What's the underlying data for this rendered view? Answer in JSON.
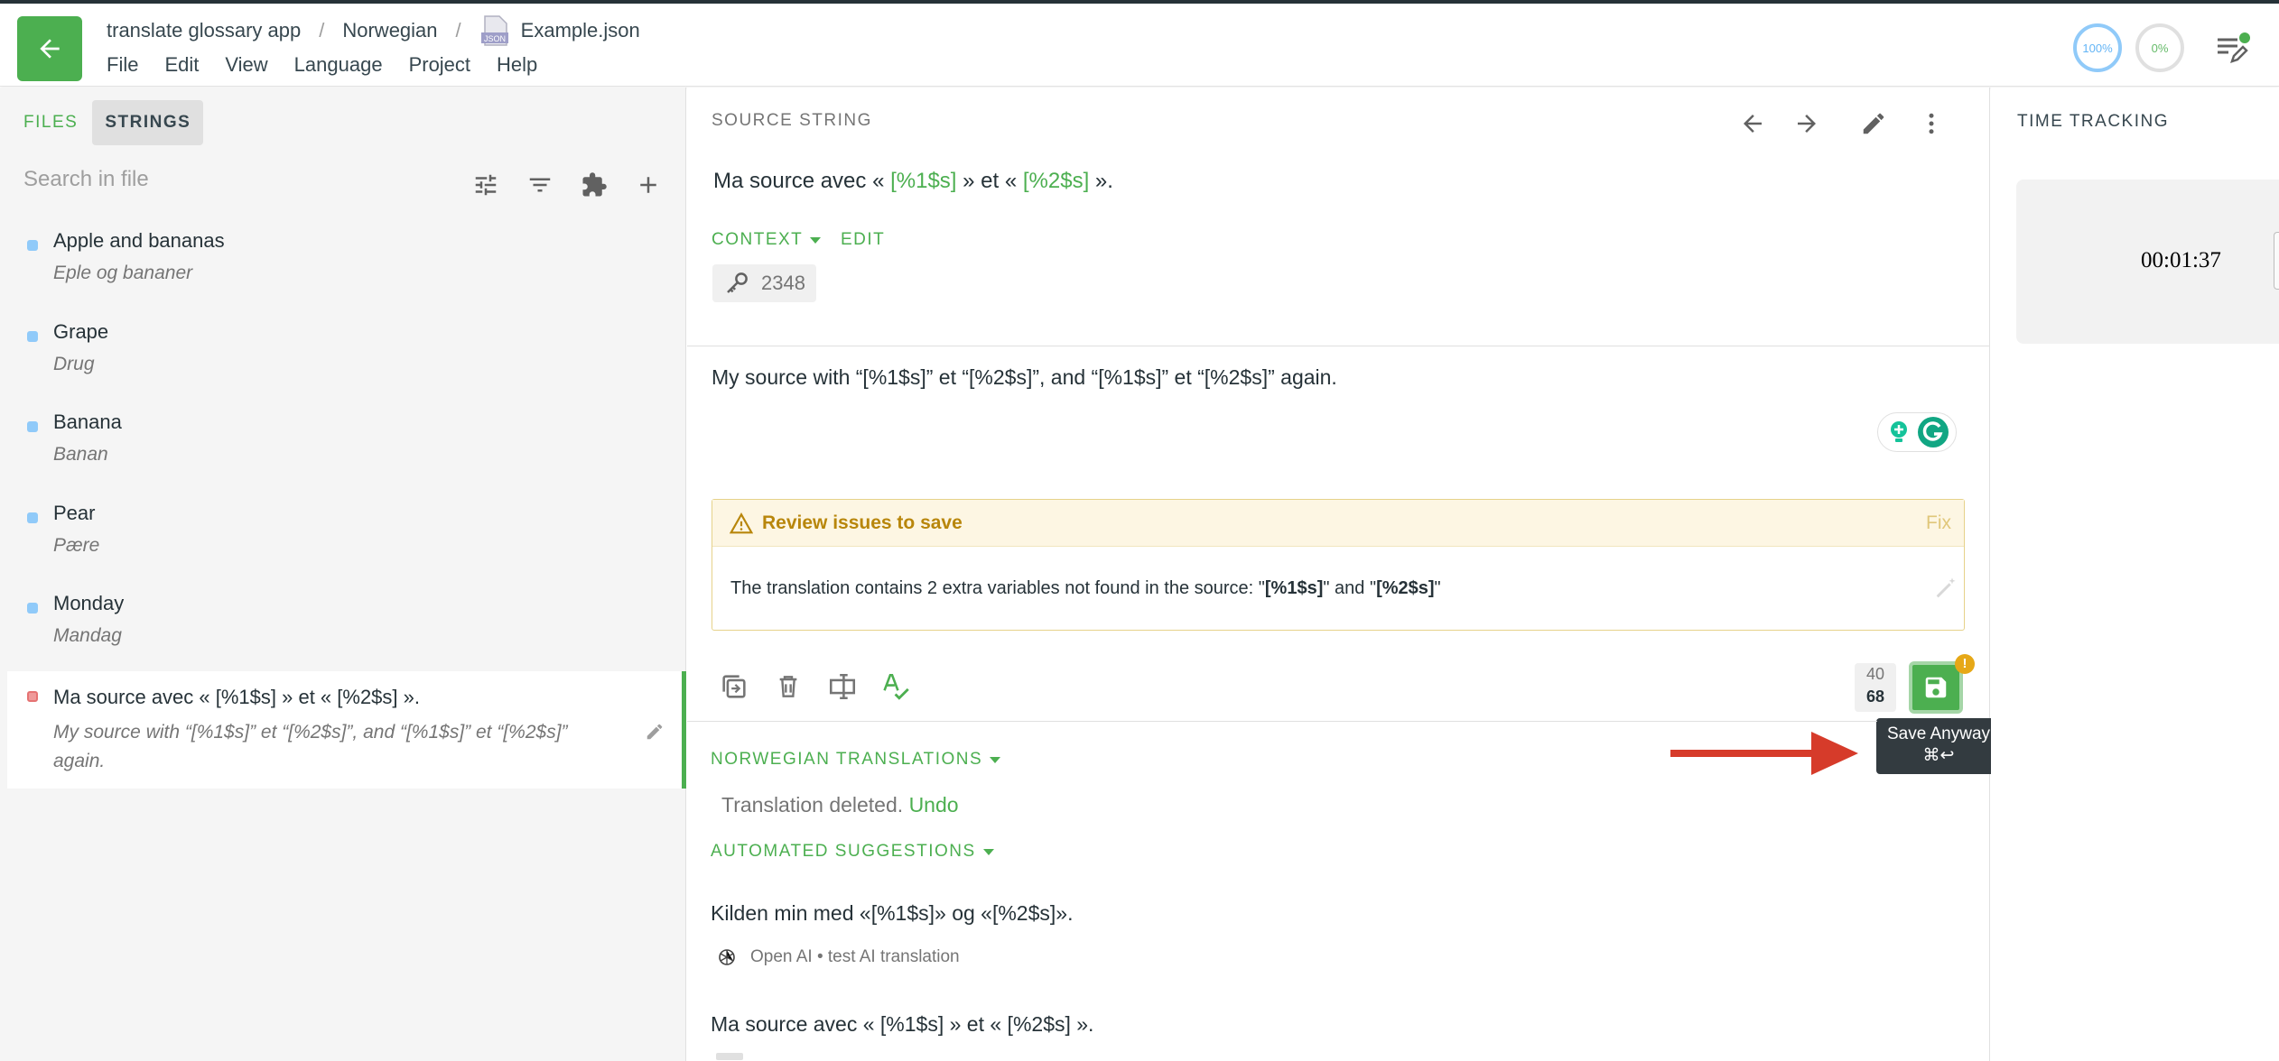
{
  "header": {
    "project": "translate glossary app",
    "language": "Norwegian",
    "file": "Example.json",
    "file_icon_text": "JSON",
    "menu": [
      "File",
      "Edit",
      "View",
      "Language",
      "Project",
      "Help"
    ],
    "progress_translated": "100%",
    "progress_approved": "0%"
  },
  "sidebar": {
    "tabs": [
      "FILES",
      "STRINGS"
    ],
    "search_placeholder": "Search in file",
    "items": [
      {
        "source": "Apple and bananas",
        "translation": "Eple og bananer"
      },
      {
        "source": "Grape",
        "translation": "Drug"
      },
      {
        "source": "Banana",
        "translation": "Banan"
      },
      {
        "source": "Pear",
        "translation": "Pære"
      },
      {
        "source": "Monday",
        "translation": "Mandag"
      },
      {
        "source": "Ma source avec « [%1$s] » et « [%2$s] ».",
        "translation": "My source with “[%1$s]” et “[%2$s]”, and “[%1$s]” et “[%2$s]” again."
      }
    ]
  },
  "source": {
    "label": "SOURCE STRING",
    "text_a": "Ma source avec « ",
    "var1": "[%1$s]",
    "text_b": " » et « ",
    "var2": "[%2$s]",
    "text_c": " ».",
    "context_label": "CONTEXT",
    "edit_label": "EDIT",
    "key_id": "2348"
  },
  "editor": {
    "text": "My source with “[%1$s]” et “[%2$s]”, and “[%1$s]” et “[%2$s]” again.",
    "issue_title": "Review issues to save",
    "issue_fix": "Fix",
    "issue_text_a": "The translation contains 2 extra variables not found in the source: \"",
    "issue_var1": "[%1$s]",
    "issue_text_b": "\" and \"",
    "issue_var2": "[%2$s]",
    "issue_text_c": "\"",
    "count_source": "40",
    "count_translation": "68",
    "save_warning": "!",
    "tooltip_line1": "Save Anyway",
    "tooltip_line2": "⌘↩"
  },
  "translations": {
    "label": "NORWEGIAN TRANSLATIONS",
    "deleted_text": "Translation deleted.",
    "undo_label": "Undo"
  },
  "suggestions": {
    "label": "AUTOMATED SUGGESTIONS",
    "items": [
      {
        "text": "Kilden min med «[%1$s]» og «[%2$s]».",
        "meta": "Open AI • test AI translation"
      },
      {
        "text": "Ma source avec « [%1$s] » et « [%2$s] »."
      }
    ]
  },
  "time_tracking": {
    "label": "TIME TRACKING",
    "time": "00:01:37"
  },
  "colors": {
    "accent": "#4caf50",
    "warning": "#e6a817",
    "annotation_arrow": "#d63b2a"
  }
}
